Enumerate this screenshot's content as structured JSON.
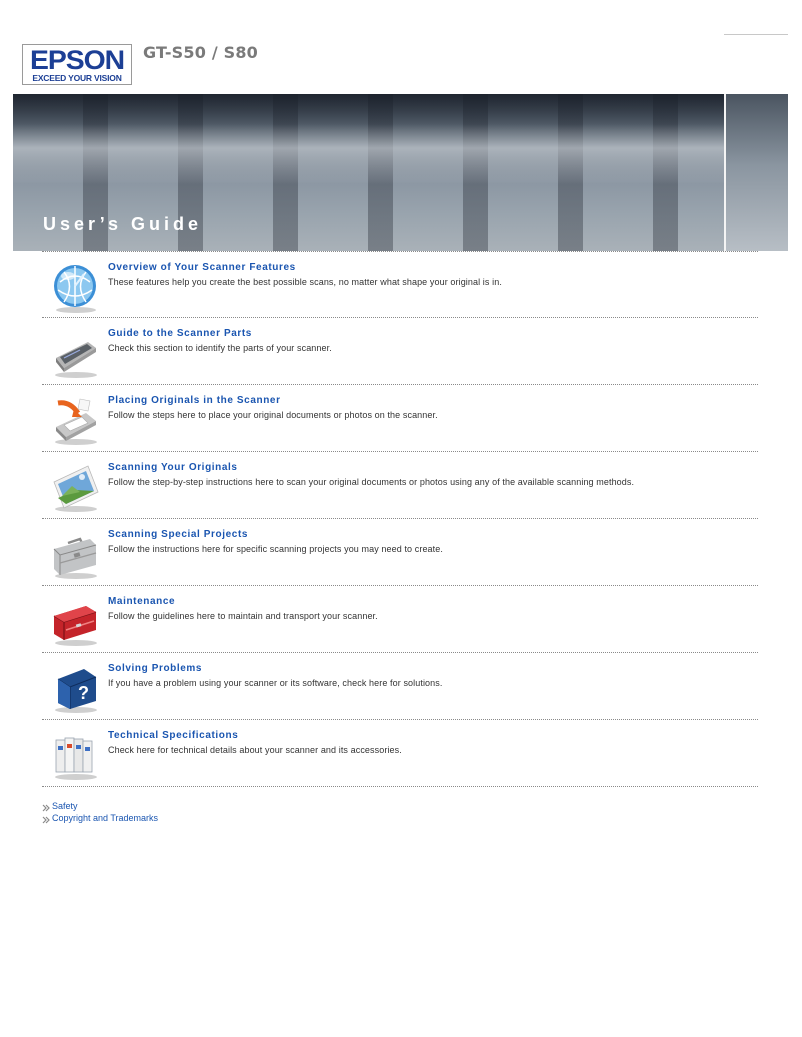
{
  "header": {
    "brand": "EPSON",
    "brand_tagline": "EXCEED YOUR VISION",
    "model": "GT-S50 / S80"
  },
  "banner": {
    "title": "User’s Guide"
  },
  "sections": [
    {
      "icon": "globe-icon",
      "title": "Overview of Your Scanner Features",
      "description": "These features help you create the best possible scans, no matter what shape your original is in."
    },
    {
      "icon": "scanner-icon",
      "title": "Guide to the Scanner Parts",
      "description": "Check this section to identify the parts of your scanner."
    },
    {
      "icon": "place-document-icon",
      "title": "Placing Originals in the Scanner",
      "description": "Follow the steps here to place your original documents or photos on the scanner."
    },
    {
      "icon": "photo-scan-icon",
      "title": "Scanning Your Originals",
      "description": "Follow the step-by-step instructions here to scan your original documents or photos using any of the available scanning methods."
    },
    {
      "icon": "briefcase-icon",
      "title": "Scanning Special Projects",
      "description": "Follow the instructions here for specific scanning projects you may need to create."
    },
    {
      "icon": "toolbox-icon",
      "title": "Maintenance",
      "description": "Follow the guidelines here to maintain and transport your scanner."
    },
    {
      "icon": "help-book-icon",
      "title": "Solving Problems",
      "description": "If you have a problem using your scanner or its software, check here for solutions."
    },
    {
      "icon": "binders-icon",
      "title": "Technical Specifications",
      "description": "Check here for technical details about your scanner and its accessories."
    }
  ],
  "footer_links": [
    {
      "label": "Safety"
    },
    {
      "label": "Copyright and Trademarks"
    }
  ],
  "colors": {
    "link": "#1a55b0",
    "brand": "#1c3f95"
  }
}
